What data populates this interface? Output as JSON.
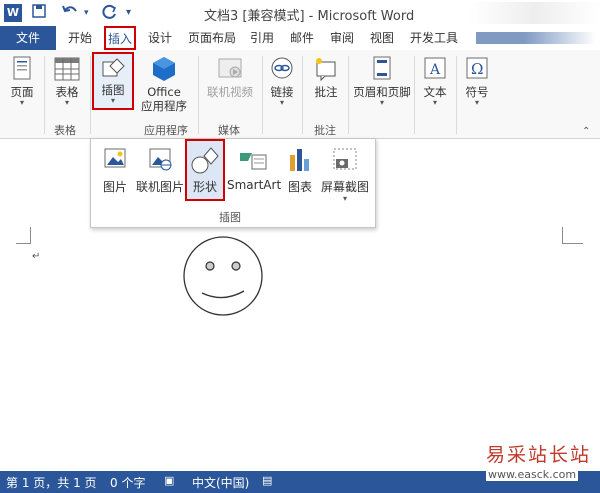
{
  "window": {
    "title": "文档3 [兼容模式] - Microsoft Word",
    "word_icon": "W",
    "quick_access": [
      "save-icon",
      "undo-icon",
      "redo-icon",
      "customize-icon"
    ]
  },
  "tabs": {
    "file": "文件",
    "items": [
      "开始",
      "插入",
      "设计",
      "页面布局",
      "引用",
      "邮件",
      "审阅",
      "视图",
      "开发工具"
    ]
  },
  "ribbon": {
    "page": "页面",
    "table": "表格",
    "illustrations": "插图",
    "office_line1": "Office",
    "office_line2": "应用程序",
    "online_video": "联机视频",
    "link": "链接",
    "comment": "批注",
    "header_footer": "页眉和页脚",
    "text": "文本",
    "symbol": "符号",
    "groups": {
      "table": "表格",
      "apps": "应用程序",
      "media": "媒体",
      "comments": "批注"
    }
  },
  "panel": {
    "picture": "图片",
    "online_picture": "联机图片",
    "shapes": "形状",
    "smartart": "SmartArt",
    "chart": "图表",
    "screenshot": "屏幕截图",
    "group_label": "插图"
  },
  "document": {
    "paragraph_mark": "↵"
  },
  "status": {
    "page": "第 1 页，共 1 页",
    "words": "0 个字",
    "language": "中文(中国)"
  },
  "watermark": {
    "text": "易采站长站",
    "url": "www.easck.com"
  },
  "colors": {
    "accent": "#2b579a",
    "highlight": "#d00000"
  }
}
